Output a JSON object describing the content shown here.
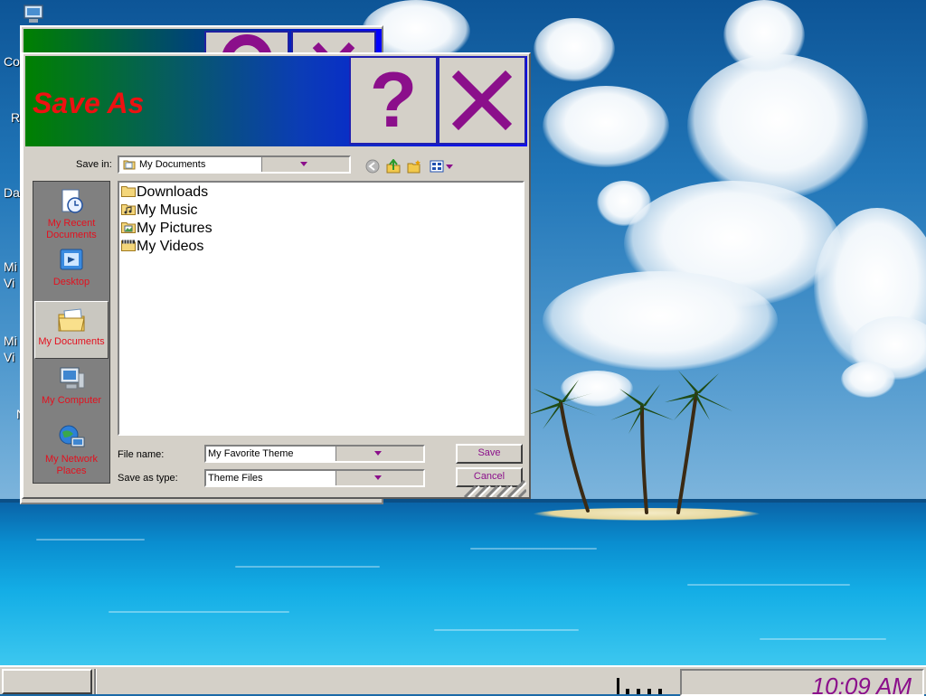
{
  "desktop": {
    "icon_labels": [
      "Co",
      "R",
      "Da",
      "Mi Vi",
      "Mi Vi",
      "N"
    ]
  },
  "dialog": {
    "title": "Save As",
    "help_button": "?",
    "close_button_icon": "close-x-icon",
    "save_in_label": "Save in:",
    "save_in_value": "My Documents",
    "toolbar_icons": [
      "back-icon",
      "up-folder-icon",
      "new-folder-icon",
      "view-menu-icon"
    ],
    "places": [
      {
        "label": "My Recent Documents",
        "icon": "recent-documents-icon",
        "selected": false
      },
      {
        "label": "Desktop",
        "icon": "desktop-icon",
        "selected": false
      },
      {
        "label": "My Documents",
        "icon": "my-documents-icon",
        "selected": true
      },
      {
        "label": "My Computer",
        "icon": "my-computer-icon",
        "selected": false
      },
      {
        "label": "My Network Places",
        "icon": "network-places-icon",
        "selected": false
      }
    ],
    "files": [
      {
        "name": "Downloads",
        "icon": "folder-icon"
      },
      {
        "name": "My Music",
        "icon": "music-folder-icon"
      },
      {
        "name": "My Pictures",
        "icon": "pictures-folder-icon"
      },
      {
        "name": "My Videos",
        "icon": "videos-folder-icon"
      }
    ],
    "file_name_label": "File name:",
    "file_name_value": "My Favorite Theme",
    "save_as_type_label": "Save as type:",
    "save_as_type_value": "Theme Files",
    "save_button": "Save",
    "cancel_button": "Cancel"
  },
  "taskbar": {
    "clock": "10:09 AM"
  },
  "colors": {
    "title_gradient_start": "#008000",
    "title_gradient_end": "#0000ff",
    "title_text": "#ee1111",
    "accent_purple": "#8b0f8b",
    "places_label": "#e3101e",
    "face": "#d4d0c8"
  }
}
